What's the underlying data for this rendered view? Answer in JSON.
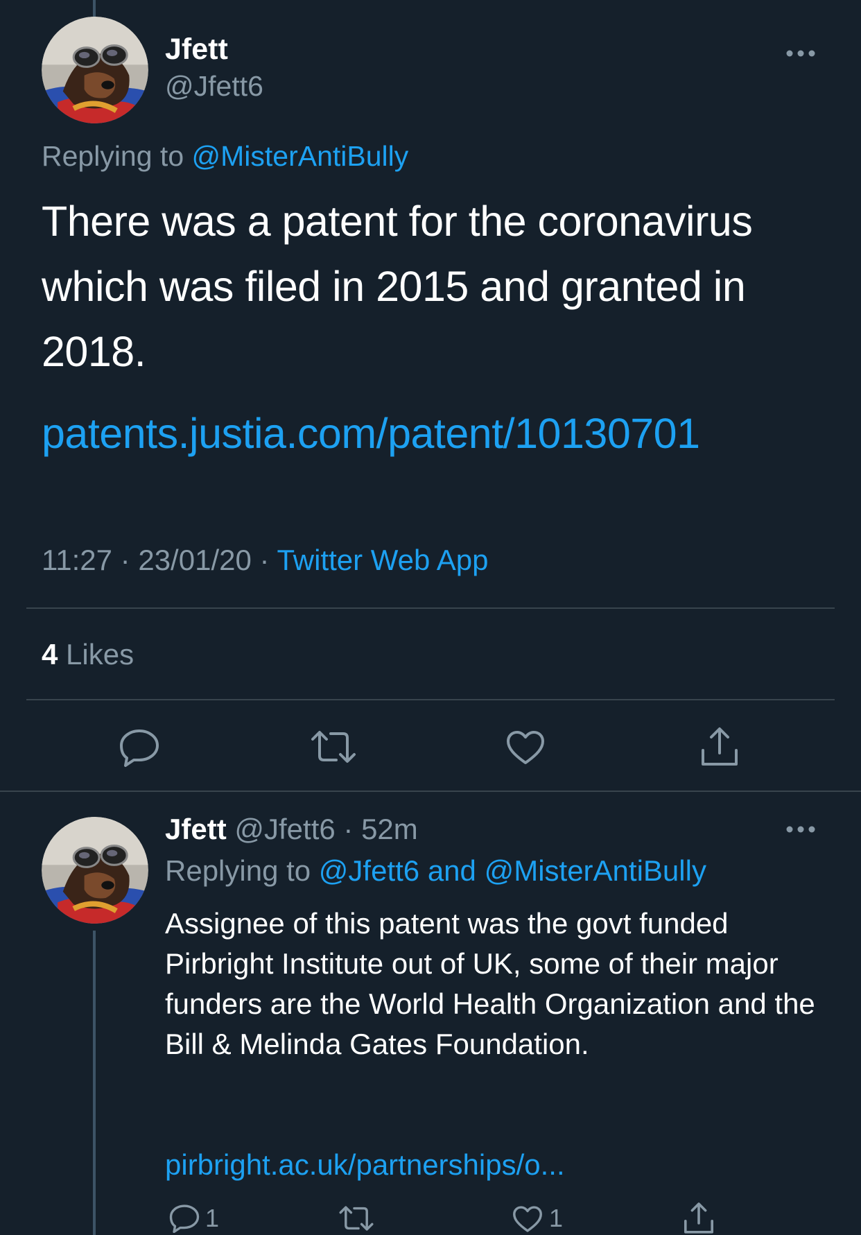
{
  "main_tweet": {
    "author_name": "Jfett",
    "author_handle": "@Jfett6",
    "replying_prefix": "Replying to",
    "replying_to": "@MisterAntiBully",
    "text": "There was a patent for the coronavirus which was filed in 2015 and granted in 2018.",
    "link": "patents.justia.com/patent/10130701",
    "time": "11:27",
    "separator": "·",
    "date": "23/01/20",
    "source": "Twitter Web App",
    "likes_count": "4",
    "likes_label": "Likes",
    "icons": [
      "more-horizontal-icon",
      "reply-icon",
      "retweet-icon",
      "like-icon",
      "share-icon"
    ]
  },
  "reply_tweet": {
    "author_name": "Jfett",
    "author_handle": "@Jfett6",
    "separator": "·",
    "timestamp": "52m",
    "replying_prefix": "Replying to",
    "replying_to": "@Jfett6 and @MisterAntiBully",
    "text": "Assignee of this patent was the govt funded Pirbright Institute out of UK, some of their major funders are the World Health Organization and the Bill & Melinda Gates Foundation.",
    "link": "pirbright.ac.uk/partnerships/o...",
    "reply_count": "1",
    "like_count": "1"
  },
  "colors": {
    "background": "#15202b",
    "text": "#ffffff",
    "muted": "#8899a6",
    "accent": "#1da1f2",
    "divider": "#38444d"
  }
}
